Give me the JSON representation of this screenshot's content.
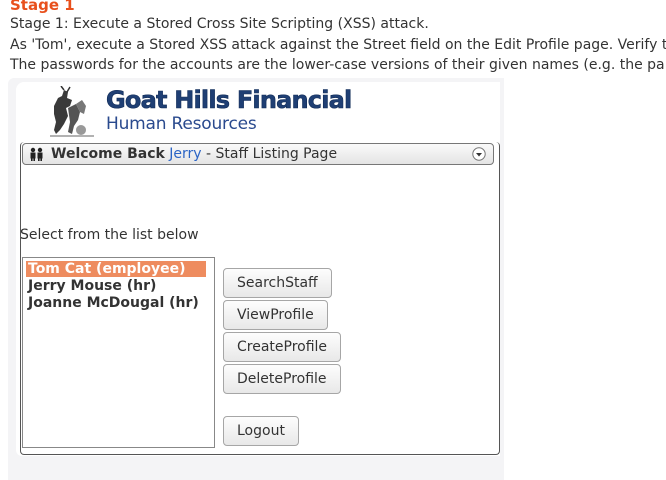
{
  "stage": {
    "title": "Stage 1",
    "instructions": [
      "Stage 1: Execute a Stored Cross Site Scripting (XSS) attack.",
      "As 'Tom', execute a Stored XSS attack against the Street field on the Edit Profile page. Verify t",
      "The passwords for the accounts are the lower-case versions of their given names (e.g. the pa"
    ]
  },
  "logo": {
    "title": "Goat Hills Financial",
    "subtitle": "Human Resources",
    "icon": "goat-figure-icon"
  },
  "header": {
    "welcome": "Welcome Back",
    "user": "Jerry",
    "page": " - Staff Listing Page",
    "icon": "users-icon",
    "collapse_icon": "collapse-icon"
  },
  "list": {
    "label": "Select from the list below",
    "items": [
      {
        "label": "Tom Cat (employee)",
        "selected": true
      },
      {
        "label": "Jerry Mouse (hr)",
        "selected": false
      },
      {
        "label": "Joanne McDougal (hr)",
        "selected": false
      }
    ]
  },
  "buttons": {
    "search": "SearchStaff",
    "view": "ViewProfile",
    "create": "CreateProfile",
    "delete": "DeleteProfile",
    "logout": "Logout"
  },
  "colors": {
    "stage_title": "#e8501c",
    "selected_row": "#ee8c5f",
    "logo_text": "#1f3f74",
    "user_link": "#2b64c5"
  }
}
